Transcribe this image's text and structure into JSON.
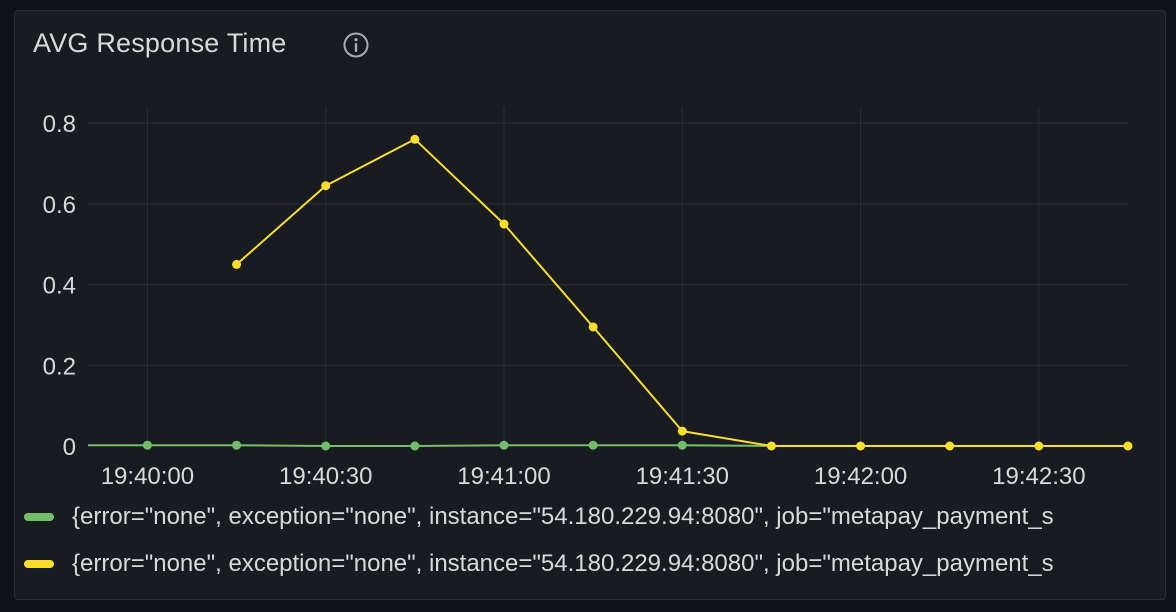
{
  "panel": {
    "title": "AVG Response Time"
  },
  "colors": {
    "background": "#181b1f",
    "grid": "#2a2d33",
    "text": "#d8d9da"
  },
  "chart_data": {
    "type": "line",
    "x_tick_labels": [
      "19:40:00",
      "19:40:30",
      "19:41:00",
      "19:41:30",
      "19:42:00",
      "19:42:30"
    ],
    "x_tick_values": [
      "19:40:00",
      "19:40:30",
      "19:41:00",
      "19:41:30",
      "19:42:00",
      "19:42:30"
    ],
    "y_tick_labels": [
      "0",
      "0.2",
      "0.4",
      "0.6",
      "0.8"
    ],
    "ylim": [
      0,
      0.84
    ],
    "xlim": [
      "19:39:50",
      "19:42:45"
    ],
    "grid": true,
    "legend": "bottom",
    "series": [
      {
        "label": "{error=\"none\", exception=\"none\", instance=\"54.180.229.94:8080\", job=\"metapay_payment_s",
        "color": "#73bf69",
        "x": [
          "19:39:50",
          "19:40:00",
          "19:40:15",
          "19:40:30",
          "19:40:45",
          "19:41:00",
          "19:41:15",
          "19:41:30",
          "19:41:45"
        ],
        "y": [
          0.002,
          0.002,
          0.002,
          0.0,
          0.0,
          0.002,
          0.002,
          0.002,
          0.0
        ],
        "markers": [
          false,
          true,
          true,
          true,
          true,
          true,
          true,
          true,
          false
        ]
      },
      {
        "label": "{error=\"none\", exception=\"none\", instance=\"54.180.229.94:8080\", job=\"metapay_payment_s",
        "color": "#fade2a",
        "x": [
          "19:40:15",
          "19:40:30",
          "19:40:45",
          "19:41:00",
          "19:41:15",
          "19:41:30",
          "19:41:45",
          "19:42:00",
          "19:42:15",
          "19:42:30",
          "19:42:45"
        ],
        "y": [
          0.45,
          0.645,
          0.76,
          0.55,
          0.295,
          0.037,
          0.0,
          0.0,
          0.0,
          0.0,
          0.0
        ],
        "markers": [
          true,
          true,
          true,
          true,
          true,
          true,
          true,
          true,
          true,
          true,
          true
        ]
      }
    ]
  }
}
